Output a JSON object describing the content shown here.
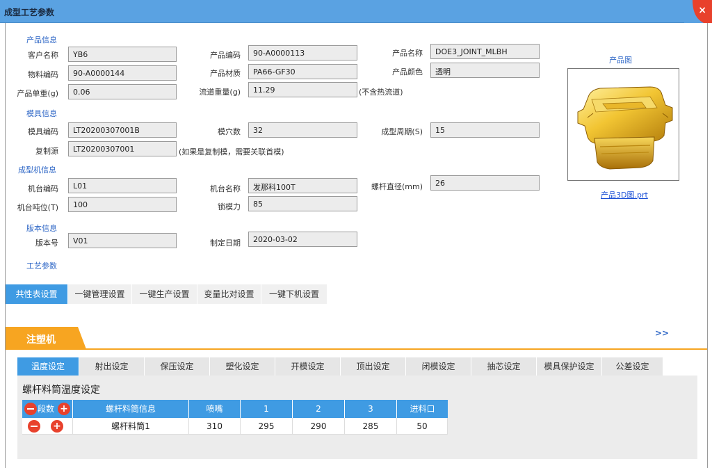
{
  "window": {
    "title": "成型工艺参数",
    "close_label": "×"
  },
  "product_section": {
    "heading": "产品信息",
    "customer_label": "客户名称",
    "customer_value": "YB6",
    "product_code_label": "产品编码",
    "product_code_value": "90-A0000113",
    "product_name_label": "产品名称",
    "product_name_value": "DOE3_JOINT_MLBH",
    "material_code_label": "物料编码",
    "material_code_value": "90-A0000144",
    "product_material_label": "产品材质",
    "product_material_value": "PA66-GF30",
    "product_color_label": "产品颜色",
    "product_color_value": "透明",
    "unit_weight_label": "产品单重(g)",
    "unit_weight_value": "0.06",
    "runner_weight_label": "流道重量(g)",
    "runner_weight_value": "11.29",
    "runner_note": "(不含热流道)"
  },
  "product_image": {
    "heading": "产品图",
    "link_text": "产品3D图.prt"
  },
  "mold_section": {
    "heading": "模具信息",
    "mold_code_label": "模具编码",
    "mold_code_value": "LT20200307001B",
    "cavities_label": "模穴数",
    "cavities_value": "32",
    "cycle_label": "成型周期(S)",
    "cycle_value": "15",
    "copy_source_label": "复制源",
    "copy_source_value": "LT20200307001",
    "copy_note": "(如果是复制模，需要关联首模)"
  },
  "machine_section": {
    "heading": "成型机信息",
    "machine_code_label": "机台编码",
    "machine_code_value": "L01",
    "machine_name_label": "机台名称",
    "machine_name_value": "发那科100T",
    "screw_diameter_label": "螺杆直径(mm)",
    "screw_diameter_value": "26",
    "tonnage_label": "机台吨位(T)",
    "tonnage_value": "100",
    "clamp_force_label": "锁模力",
    "clamp_force_value": "85"
  },
  "version_section": {
    "heading": "版本信息",
    "version_label": "版本号",
    "version_value": "V01",
    "date_label": "制定日期",
    "date_value": "2020-03-02"
  },
  "process_heading": "工艺参数",
  "settings_tabs": [
    "共性表设置",
    "一键管理设置",
    "一键生产设置",
    "变量比对设置",
    "一键下机设置"
  ],
  "injection_tab": {
    "label": "注塑机",
    "more": ">>"
  },
  "injection_tabs": [
    "温度设定",
    "射出设定",
    "保压设定",
    "塑化设定",
    "开模设定",
    "顶出设定",
    "闭模设定",
    "抽芯设定",
    "模具保护设定",
    "公差设定"
  ],
  "temperature_panel": {
    "title": "螺杆料筒温度设定",
    "segments_label": "段数",
    "headers": [
      "螺杆料筒信息",
      "喷嘴",
      "1",
      "2",
      "3",
      "进料口"
    ],
    "rows": [
      {
        "name": "螺杆料筒1",
        "values": [
          "310",
          "295",
          "290",
          "285",
          "50"
        ]
      }
    ]
  },
  "colors": {
    "title_bar": "#5aa2e2",
    "accent_blue": "#3f9be3",
    "accent_orange": "#f7a521",
    "close_red": "#e8412c",
    "section_blue": "#2d66c6"
  },
  "icons": [
    "close-icon",
    "minus-circle-icon",
    "plus-circle-icon",
    "product-3d-image"
  ]
}
